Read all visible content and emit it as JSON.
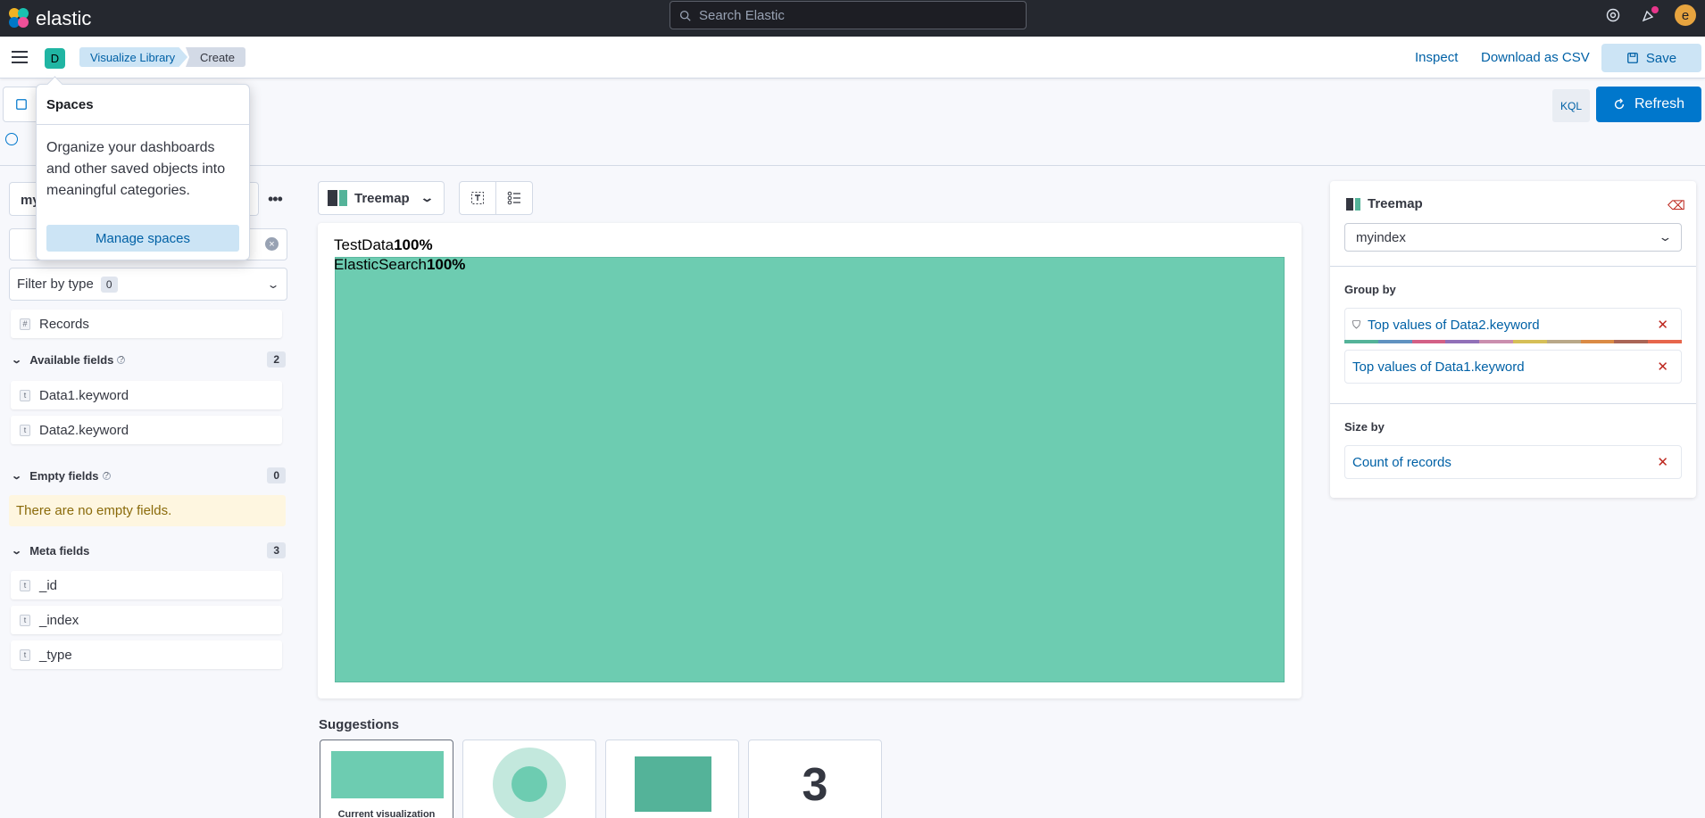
{
  "app": {
    "brand": "elastic"
  },
  "search": {
    "placeholder": "Search Elastic"
  },
  "space": {
    "badge": "D"
  },
  "breadcrumbs": [
    "Visualize Library",
    "Create"
  ],
  "header_actions": {
    "inspect": "Inspect",
    "download": "Download as CSV",
    "save": "Save"
  },
  "query": {
    "language": "KQL",
    "refresh": "Refresh"
  },
  "left": {
    "index": "my",
    "filter_by_type": "Filter by type",
    "filter_count": "0",
    "records": "Records",
    "available": {
      "label": "Available fields",
      "count": "2",
      "fields": [
        "Data1.keyword",
        "Data2.keyword"
      ]
    },
    "empty": {
      "label": "Empty fields",
      "count": "0",
      "message": "There are no empty fields."
    },
    "meta": {
      "label": "Meta fields",
      "count": "3",
      "fields": [
        "_id",
        "_index",
        "_type"
      ]
    }
  },
  "popover": {
    "title": "Spaces",
    "body": "Organize your dashboards and other saved objects into meaningful categories.",
    "button": "Manage spaces"
  },
  "workspace": {
    "vis_type": "Treemap"
  },
  "chart_data": {
    "type": "treemap",
    "levels": [
      {
        "label": "TestData",
        "value": "100%"
      },
      {
        "label": "ElasticSearch",
        "value": "100%"
      }
    ]
  },
  "suggestions": {
    "title": "Suggestions",
    "current": "Current visualization",
    "metric": "3"
  },
  "config": {
    "title": "Treemap",
    "index": "myindex",
    "group_by": "Group by",
    "dims": [
      "Top values of Data2.keyword",
      "Top values of Data1.keyword"
    ],
    "size_by": "Size by",
    "size_dim": "Count of records"
  },
  "colors": {
    "accent": "#0077cc",
    "treemap": "#6dccb1",
    "topbar": "#25282f"
  }
}
